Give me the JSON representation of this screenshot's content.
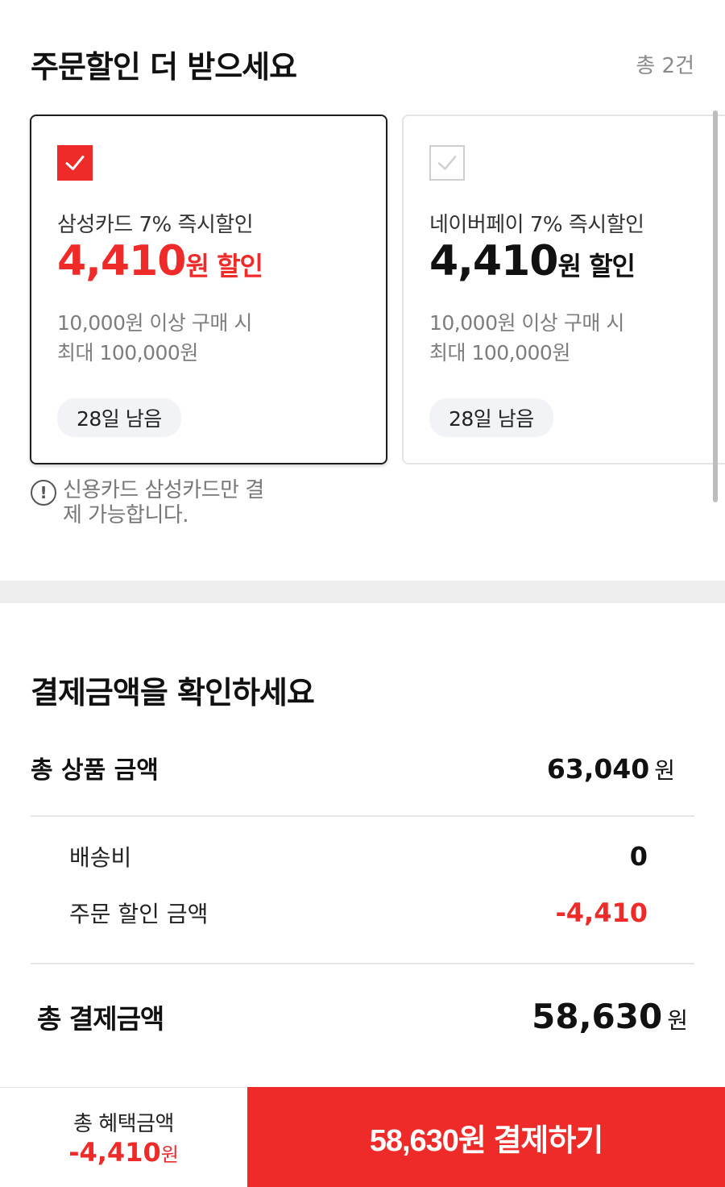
{
  "coupons": {
    "title": "주문할인 더 받으세요",
    "count": "총 2건",
    "cards": [
      {
        "checked": true,
        "name": "삼성카드 7% 즉시할인",
        "amount": "4,410",
        "unit": "원 할인",
        "condition_1": "10,000원 이상 구매 시",
        "condition_2": "최대 100,000원",
        "remaining": "28일 남음"
      },
      {
        "checked": false,
        "name": "네이버페이 7% 즉시할인",
        "amount": "4,410",
        "unit": "원 할인",
        "condition_1": "10,000원 이상 구매 시",
        "condition_2": "최대 100,000원",
        "remaining": "28일 남음"
      }
    ],
    "notice": "신용카드 삼성카드만 결제 가능합니다.",
    "notice_icon": "exclamation-circle-icon"
  },
  "summary": {
    "title": "결제금액을 확인하세요",
    "total_product_label": "총 상품 금액",
    "total_product_value": "63,040",
    "currency": "원",
    "shipping_label": "배송비",
    "shipping_value": "0",
    "discount_label": "주문 할인 금액",
    "discount_value": "-4,410",
    "total_pay_label": "총 결제금액",
    "total_pay_value": "58,630"
  },
  "bottom": {
    "benefit_label": "총 혜택금액",
    "benefit_value": "-4,410",
    "benefit_unit": "원",
    "pay_button_label": "58,630원 결제하기"
  },
  "colors": {
    "accent": "#ef2b2a",
    "muted": "#7d7d7d",
    "band": "#eeeeee"
  }
}
